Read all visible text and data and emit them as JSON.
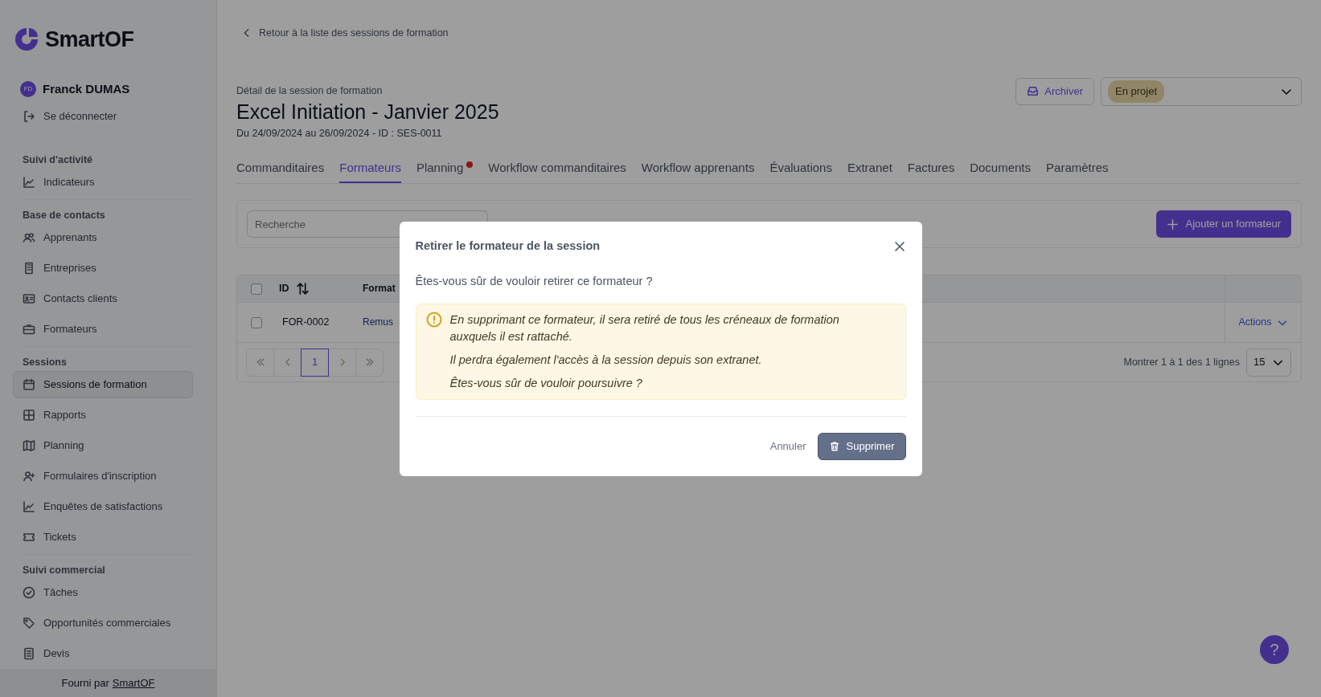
{
  "sidebar": {
    "logo": "SmartOF",
    "user": {
      "initials": "FD",
      "name": "Franck DUMAS"
    },
    "logout": "Se déconnecter",
    "sections": [
      {
        "heading": "Suivi d'activité",
        "items": [
          {
            "label": "Indicateurs",
            "selected": false
          }
        ]
      },
      {
        "heading": "Base de contacts",
        "items": [
          {
            "label": "Apprenants",
            "selected": false
          },
          {
            "label": "Entreprises",
            "selected": false
          },
          {
            "label": "Contacts clients",
            "selected": false
          },
          {
            "label": "Formateurs",
            "selected": false
          }
        ]
      },
      {
        "heading": "Sessions",
        "items": [
          {
            "label": "Sessions de formation",
            "selected": true
          },
          {
            "label": "Rapports",
            "selected": false
          },
          {
            "label": "Planning",
            "selected": false
          },
          {
            "label": "Formulaires d'inscription",
            "selected": false
          },
          {
            "label": "Enquêtes de satisfactions",
            "selected": false
          },
          {
            "label": "Tickets",
            "selected": false
          }
        ]
      },
      {
        "heading": "Suivi commercial",
        "items": [
          {
            "label": "Tâches",
            "selected": false
          },
          {
            "label": "Opportunités commerciales",
            "selected": false
          },
          {
            "label": "Devis",
            "selected": false
          }
        ]
      }
    ],
    "footer": {
      "text": "Fourni par",
      "link": "SmartOF"
    }
  },
  "back_link": "Retour à la liste des sessions de formation",
  "header": {
    "subtitle": "Détail de la session de formation",
    "title": "Excel Initiation - Janvier 2025",
    "dates": "Du 24/09/2024 au 26/09/2024 - ID : SES-0011",
    "archive_button": "Archiver",
    "status": "En projet"
  },
  "tabs": [
    {
      "label": "Commanditaires",
      "selected": false,
      "alert": false
    },
    {
      "label": "Formateurs",
      "selected": true,
      "alert": false
    },
    {
      "label": "Planning",
      "selected": false,
      "alert": true
    },
    {
      "label": "Workflow commanditaires",
      "selected": false,
      "alert": false
    },
    {
      "label": "Workflow apprenants",
      "selected": false,
      "alert": false
    },
    {
      "label": "Évaluations",
      "selected": false,
      "alert": false
    },
    {
      "label": "Extranet",
      "selected": false,
      "alert": false
    },
    {
      "label": "Factures",
      "selected": false,
      "alert": false
    },
    {
      "label": "Documents",
      "selected": false,
      "alert": false
    },
    {
      "label": "Paramètres",
      "selected": false,
      "alert": false
    }
  ],
  "toolbar": {
    "search": {
      "placeholder": "Recherche"
    },
    "add_button": "Ajouter un formateur"
  },
  "table": {
    "header_checked": false,
    "columns": [
      "ID",
      "Format"
    ],
    "rows": [
      {
        "checked": false,
        "id": "FOR-0002",
        "name": "Remus",
        "actions": "Actions"
      }
    ],
    "pages": [
      {
        "label": "1",
        "selected": true
      }
    ],
    "summary": "Montrer 1 à 1 des 1 lignes",
    "page_size": "15"
  },
  "modal": {
    "title": "Retirer le formateur de la session",
    "question": "Êtes-vous sûr de vouloir retirer ce formateur ?",
    "alert": [
      "En supprimant ce formateur, il sera retiré de tous les créneaux de formation auxquels il est rattaché.",
      "Il perdra également l'accès à la session depuis son extranet.",
      "Êtes-vous sûr de vouloir poursuivre ?"
    ],
    "cancel": "Annuler",
    "confirm": "Supprimer"
  },
  "help": "?"
}
